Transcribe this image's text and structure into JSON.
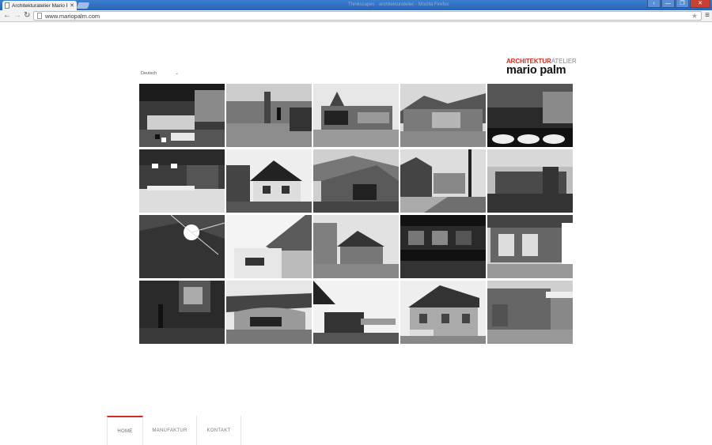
{
  "browser": {
    "tab_title": "Architekturatelier Mario P",
    "tab_close": "✕",
    "faded_title": "Thinkscapes · architekturatelier - Mozilla Firefox",
    "back_icon": "arrow-left-icon",
    "forward_icon": "arrow-right-icon",
    "reload_icon": "reload-icon",
    "url": "www.mariopalm.com",
    "window_controls": [
      "‹",
      "—",
      "❐",
      "✕"
    ]
  },
  "language_select": {
    "value": "Deutsch",
    "arrow": "⌄"
  },
  "logo": {
    "line1_red": "ARCHITEKTUR",
    "line1_grey": "ATELIER",
    "name": "mario palm",
    "accent_color": "#d52b1e"
  },
  "gallery": {
    "columns": 5,
    "rows": 4,
    "tile_count": 20
  },
  "footer_nav": {
    "items": [
      {
        "label": "HOME",
        "active": true
      },
      {
        "label": "MANUFAKTUR",
        "active": false
      },
      {
        "label": "KONTAKT",
        "active": false
      }
    ]
  }
}
